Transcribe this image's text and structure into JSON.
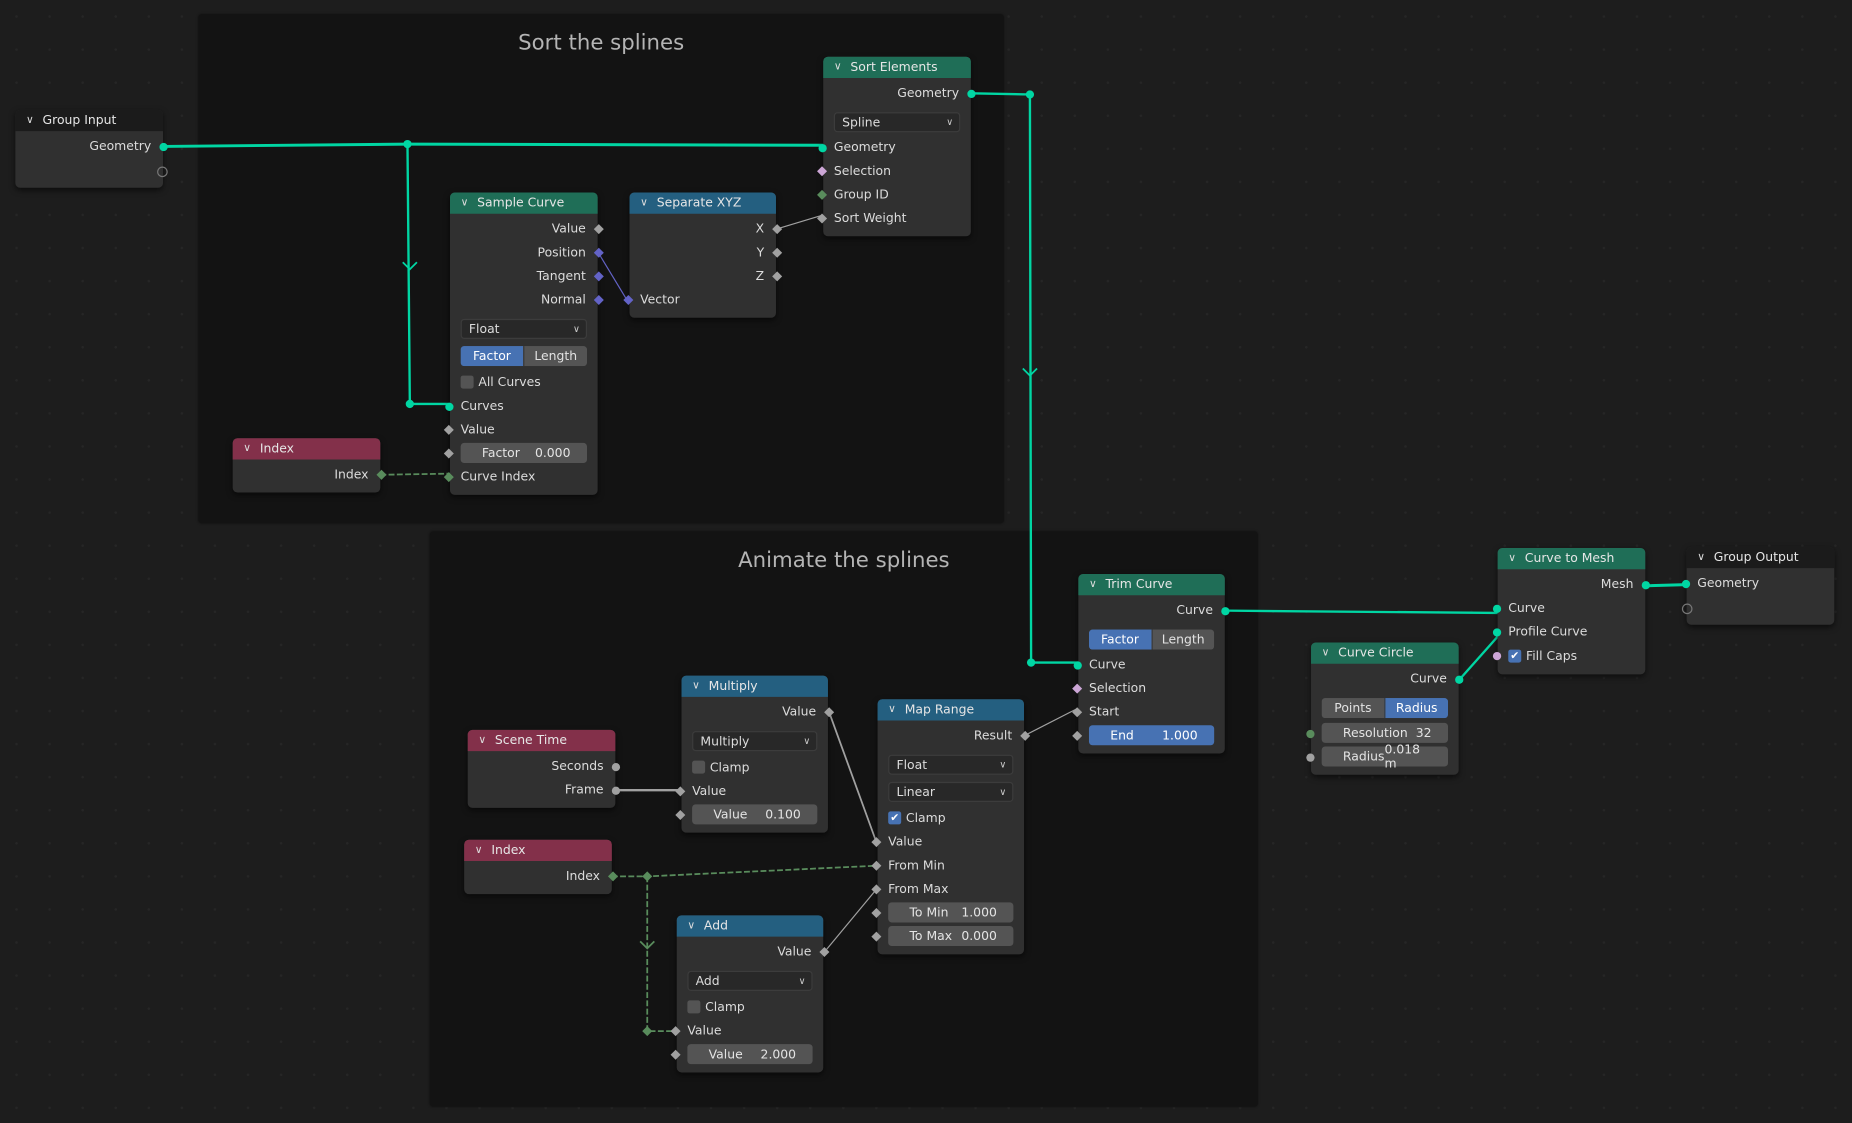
{
  "colors": {
    "geometry_socket": "#00d6a3",
    "float_socket": "#a1a1a1",
    "vector_socket": "#6363c7",
    "int_socket": "#598c5c",
    "bool_socket": "#cca6d6",
    "header_geometry": "#1f6e57",
    "header_converter": "#245f80",
    "header_input": "#83304a",
    "header_group": "#1b1b1b",
    "toggle_active": "#4772b3"
  },
  "frames": [
    {
      "id": "sort",
      "label": "Sort the splines"
    },
    {
      "id": "animate",
      "label": "Animate the splines"
    }
  ],
  "nodes": [
    {
      "id": "group_input",
      "title": "Group Input",
      "header": "header_group",
      "rows": [
        {
          "kind": "out",
          "label": "Geometry",
          "socket": "geometry"
        },
        {
          "kind": "out",
          "label": "",
          "socket": "empty"
        }
      ]
    },
    {
      "id": "sort_elements",
      "title": "Sort Elements",
      "header": "header_geometry",
      "rows": [
        {
          "kind": "out",
          "label": "Geometry",
          "socket": "geometry"
        },
        {
          "kind": "dropdown",
          "value": "Spline"
        },
        {
          "kind": "in",
          "label": "Geometry",
          "socket": "geometry"
        },
        {
          "kind": "in",
          "label": "Selection",
          "socket": "bool"
        },
        {
          "kind": "in",
          "label": "Group ID",
          "socket": "int"
        },
        {
          "kind": "in",
          "label": "Sort Weight",
          "socket": "float"
        }
      ]
    },
    {
      "id": "sample_curve",
      "title": "Sample Curve",
      "header": "header_geometry",
      "rows": [
        {
          "kind": "out",
          "label": "Value",
          "socket": "float"
        },
        {
          "kind": "out",
          "label": "Position",
          "socket": "vector"
        },
        {
          "kind": "out",
          "label": "Tangent",
          "socket": "vector"
        },
        {
          "kind": "out",
          "label": "Normal",
          "socket": "vector"
        },
        {
          "kind": "dropdown",
          "value": "Float"
        },
        {
          "kind": "toggle",
          "options": [
            "Factor",
            "Length"
          ],
          "active": 0
        },
        {
          "kind": "checkbox",
          "label": "All Curves",
          "checked": false
        },
        {
          "kind": "in",
          "label": "Curves",
          "socket": "geometry"
        },
        {
          "kind": "in",
          "label": "Value",
          "socket": "float"
        },
        {
          "kind": "field",
          "label": "Factor",
          "value": "0.000",
          "socket": "float"
        },
        {
          "kind": "in",
          "label": "Curve Index",
          "socket": "int"
        }
      ]
    },
    {
      "id": "separate_xyz",
      "title": "Separate XYZ",
      "header": "header_converter",
      "rows": [
        {
          "kind": "out",
          "label": "X",
          "socket": "float"
        },
        {
          "kind": "out",
          "label": "Y",
          "socket": "float"
        },
        {
          "kind": "out",
          "label": "Z",
          "socket": "float"
        },
        {
          "kind": "in",
          "label": "Vector",
          "socket": "vector"
        }
      ]
    },
    {
      "id": "index_top",
      "title": "Index",
      "header": "header_input",
      "rows": [
        {
          "kind": "out",
          "label": "Index",
          "socket": "int"
        }
      ]
    },
    {
      "id": "scene_time",
      "title": "Scene Time",
      "header": "header_input",
      "rows": [
        {
          "kind": "out",
          "label": "Seconds",
          "socket": "floatc"
        },
        {
          "kind": "out",
          "label": "Frame",
          "socket": "floatc"
        }
      ]
    },
    {
      "id": "multiply",
      "title": "Multiply",
      "header": "header_converter",
      "rows": [
        {
          "kind": "out",
          "label": "Value",
          "socket": "float"
        },
        {
          "kind": "dropdown",
          "value": "Multiply"
        },
        {
          "kind": "checkbox",
          "label": "Clamp",
          "checked": false
        },
        {
          "kind": "in",
          "label": "Value",
          "socket": "float"
        },
        {
          "kind": "field",
          "label": "Value",
          "value": "0.100",
          "socket": "float"
        }
      ]
    },
    {
      "id": "index_bottom",
      "title": "Index",
      "header": "header_input",
      "rows": [
        {
          "kind": "out",
          "label": "Index",
          "socket": "int"
        }
      ]
    },
    {
      "id": "add",
      "title": "Add",
      "header": "header_converter",
      "rows": [
        {
          "kind": "out",
          "label": "Value",
          "socket": "float"
        },
        {
          "kind": "dropdown",
          "value": "Add"
        },
        {
          "kind": "checkbox",
          "label": "Clamp",
          "checked": false
        },
        {
          "kind": "in",
          "label": "Value",
          "socket": "float"
        },
        {
          "kind": "field",
          "label": "Value",
          "value": "2.000",
          "socket": "float"
        }
      ]
    },
    {
      "id": "map_range",
      "title": "Map Range",
      "header": "header_converter",
      "rows": [
        {
          "kind": "out",
          "label": "Result",
          "socket": "float"
        },
        {
          "kind": "dropdown",
          "value": "Float"
        },
        {
          "kind": "dropdown",
          "value": "Linear"
        },
        {
          "kind": "checkbox",
          "label": "Clamp",
          "checked": true
        },
        {
          "kind": "in",
          "label": "Value",
          "socket": "float"
        },
        {
          "kind": "in",
          "label": "From Min",
          "socket": "float"
        },
        {
          "kind": "in",
          "label": "From Max",
          "socket": "float"
        },
        {
          "kind": "field",
          "label": "To Min",
          "value": "1.000",
          "socket": "float"
        },
        {
          "kind": "field",
          "label": "To Max",
          "value": "0.000",
          "socket": "float"
        }
      ]
    },
    {
      "id": "trim_curve",
      "title": "Trim Curve",
      "header": "header_geometry",
      "rows": [
        {
          "kind": "out",
          "label": "Curve",
          "socket": "geometry"
        },
        {
          "kind": "toggle",
          "options": [
            "Factor",
            "Length"
          ],
          "active": 0
        },
        {
          "kind": "in",
          "label": "Curve",
          "socket": "geometry"
        },
        {
          "kind": "in",
          "label": "Selection",
          "socket": "bool"
        },
        {
          "kind": "in",
          "label": "Start",
          "socket": "float"
        },
        {
          "kind": "field",
          "label": "End",
          "value": "1.000",
          "socket": "float",
          "highlight": true
        }
      ]
    },
    {
      "id": "curve_circle",
      "title": "Curve Circle",
      "header": "header_geometry",
      "rows": [
        {
          "kind": "out",
          "label": "Curve",
          "socket": "geometry"
        },
        {
          "kind": "toggle",
          "options": [
            "Points",
            "Radius"
          ],
          "active": 1
        },
        {
          "kind": "field",
          "label": "Resolution",
          "value": "32",
          "socket": "intc"
        },
        {
          "kind": "field",
          "label": "Radius",
          "value": "0.018 m",
          "socket": "floatc"
        }
      ]
    },
    {
      "id": "curve_to_mesh",
      "title": "Curve to Mesh",
      "header": "header_geometry",
      "rows": [
        {
          "kind": "out",
          "label": "Mesh",
          "socket": "geometry"
        },
        {
          "kind": "in",
          "label": "Curve",
          "socket": "geometry"
        },
        {
          "kind": "in",
          "label": "Profile Curve",
          "socket": "geometry"
        },
        {
          "kind": "checkbox",
          "label": "Fill Caps",
          "checked": true,
          "socket": "boolc"
        }
      ]
    },
    {
      "id": "group_output",
      "title": "Group Output",
      "header": "header_group",
      "rows": [
        {
          "kind": "in",
          "label": "Geometry",
          "socket": "geometry"
        },
        {
          "kind": "in",
          "label": "",
          "socket": "empty"
        }
      ]
    }
  ]
}
